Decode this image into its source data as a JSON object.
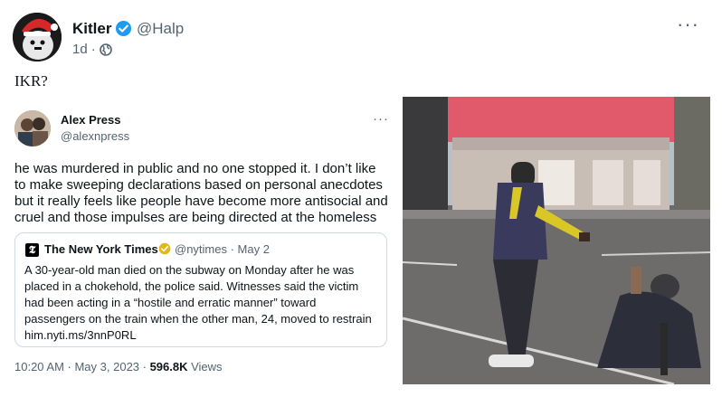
{
  "post": {
    "author_name": "Kitler",
    "author_handle": "@Halp",
    "age": "1d",
    "separator": "·",
    "more_label": "···",
    "text": "IKR?"
  },
  "embedded": {
    "author_name": "Alex Press",
    "author_handle": "@alexnpress",
    "more_label": "···",
    "body_lines": [
      "he was murdered in public and no one stopped it. I don’t like",
      "to make sweeping declarations based on personal anecdotes",
      "but it really feels like people have become more antisocial and",
      "cruel and those impulses are being directed at the homeless"
    ],
    "quote": {
      "logo_letter": "𝕿",
      "source_name": "The New York Times",
      "source_meta": "@nytimes · May 2",
      "body_lines": [
        "A 30-year-old man died on the subway on Monday after he was",
        "placed in a chokehold, the police said. Witnesses said the victim",
        "had been acting in a “hostile and erratic manner” toward",
        "passengers on the train when the other man, 24, moved to restrain",
        "him.nyti.ms/3nnP0RL"
      ]
    },
    "timestamp": "10:20 AM · May 3, 2023 · ",
    "views_count": "596.8K",
    "views_label": " Views"
  },
  "colors": {
    "verified_blue": "#1d9bf0",
    "gold_badge": "#e2b719",
    "text_primary": "#0f1419",
    "text_secondary": "#536471",
    "border": "#cfd9de"
  }
}
